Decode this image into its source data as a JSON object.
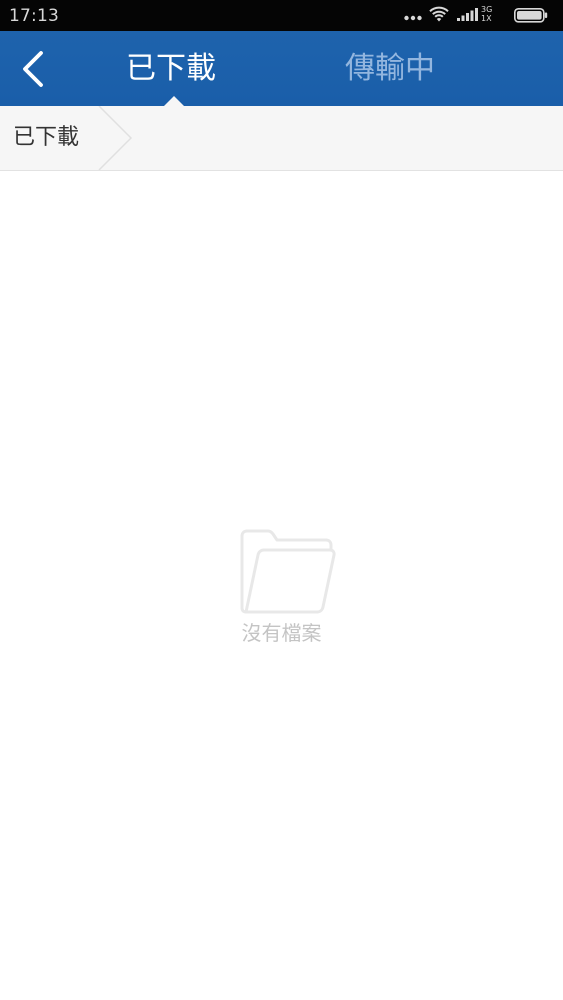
{
  "status_bar": {
    "time": "17:13",
    "network_type": "3G",
    "network_sub": "1X",
    "icons": [
      "more-dots-icon",
      "wifi-icon",
      "cellular-signal-icon",
      "battery-icon"
    ]
  },
  "header": {
    "tabs": [
      {
        "label": "已下載",
        "active": true
      },
      {
        "label": "傳輸中",
        "active": false
      }
    ],
    "background_color": "#1e63ad",
    "active_tab_color": "#ffffff",
    "inactive_tab_color": "#93b6df"
  },
  "breadcrumb": {
    "items": [
      {
        "label": "已下載"
      }
    ]
  },
  "empty_state": {
    "icon": "empty-folder-icon",
    "message": "沒有檔案"
  }
}
